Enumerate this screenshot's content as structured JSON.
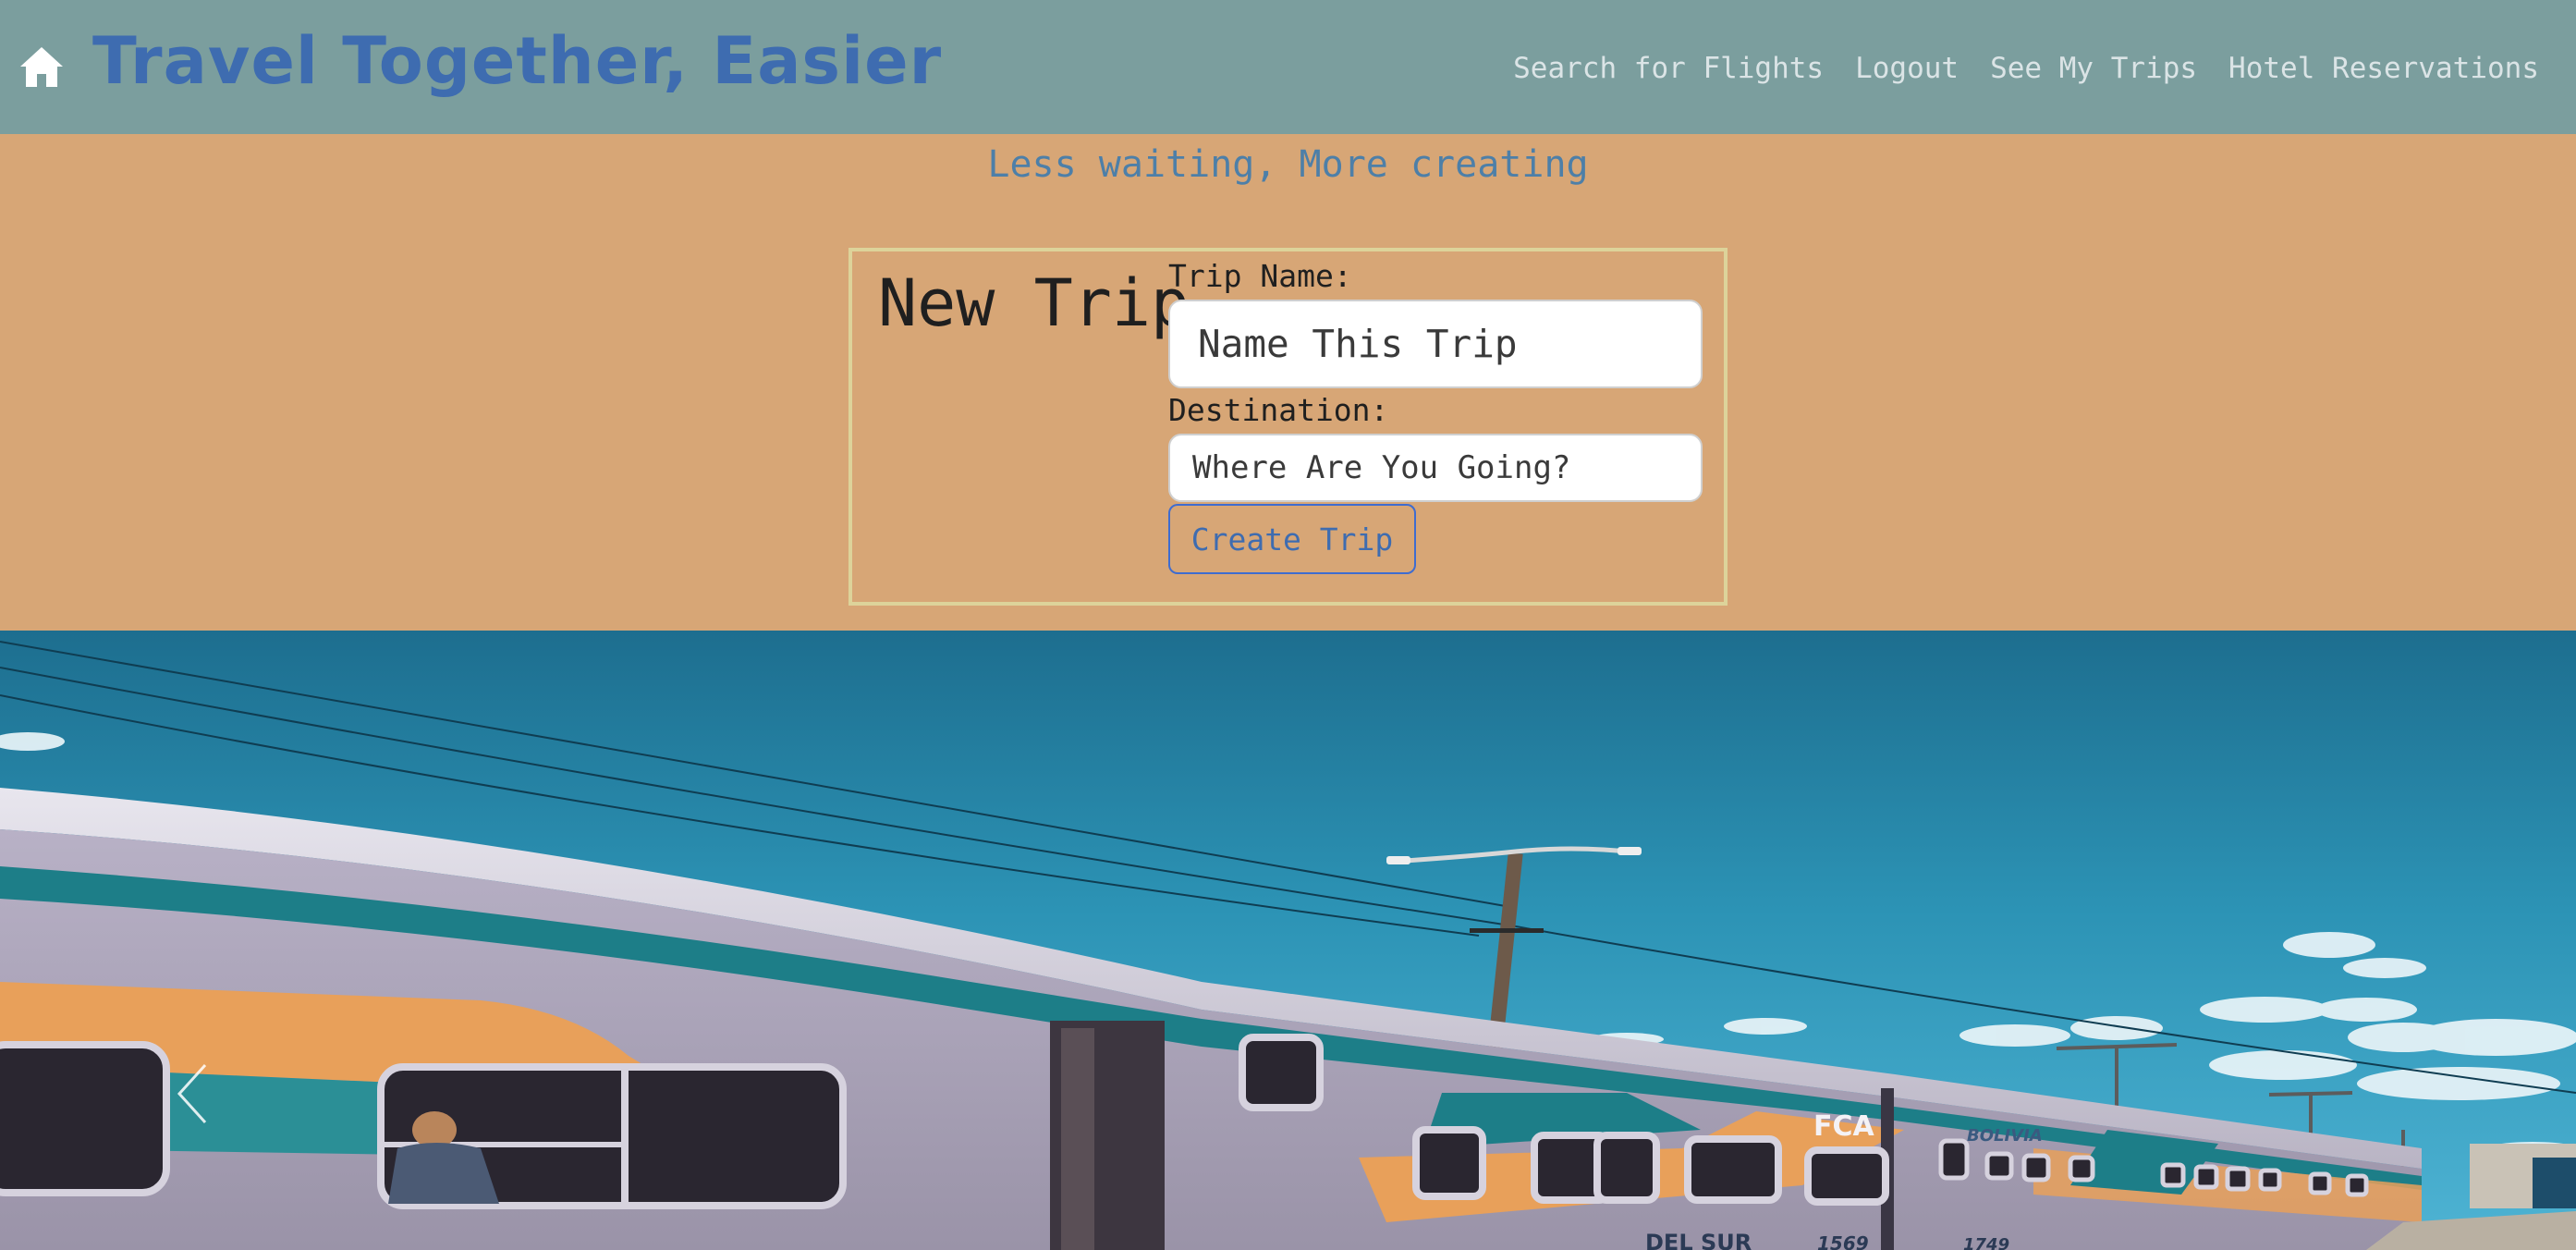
{
  "header": {
    "home_icon": "home-icon",
    "title": "Travel Together, Easier",
    "nav": [
      {
        "label": "Search for Flights"
      },
      {
        "label": "Logout"
      },
      {
        "label": "See My Trips"
      },
      {
        "label": "Hotel Reservations"
      }
    ]
  },
  "tagline": "Less waiting, More creating",
  "form": {
    "title": "New Trip",
    "trip_name_label": "Trip Name:",
    "trip_name_placeholder": "Name This Trip",
    "destination_label": "Destination:",
    "destination_placeholder": "Where Are You Going?",
    "submit_label": "Create Trip"
  },
  "hero": {
    "prev_icon": "chevron-left-icon",
    "train_markings": [
      "FCA",
      "BOLIVIA",
      "DEL SUR",
      "1569",
      "1749"
    ]
  },
  "colors": {
    "header_bg": "#7b9e9e",
    "page_bg": "#d7a676",
    "brand_blue": "#3e6cb0",
    "nav_text": "#dbe4e6",
    "card_border": "#ddd39a"
  }
}
